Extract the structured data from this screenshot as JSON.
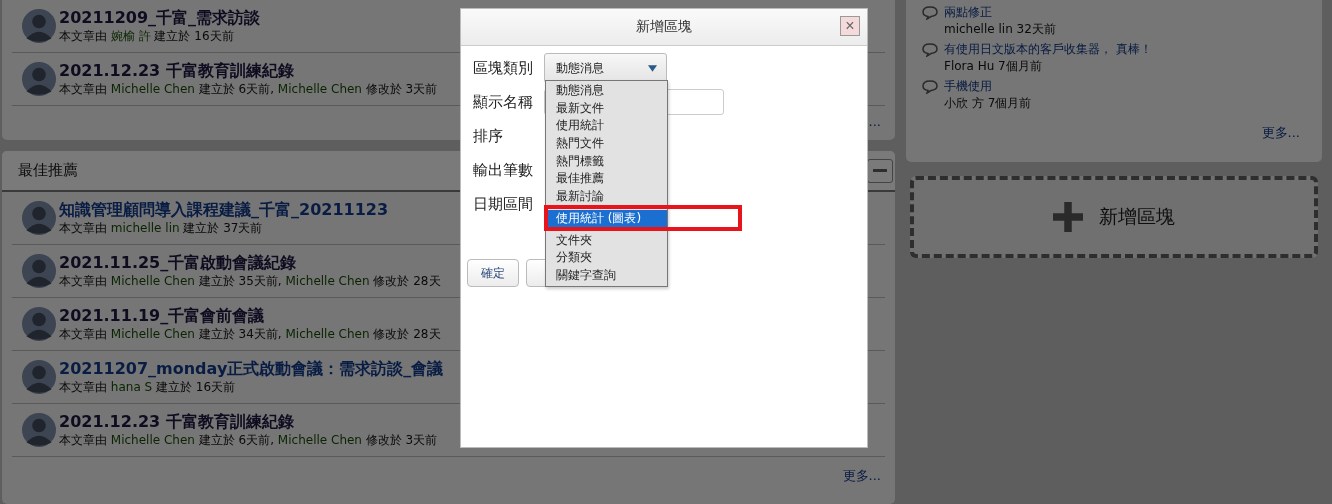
{
  "articles_panel": {
    "rows": [
      {
        "title": "20211209_千富_需求訪談",
        "visited": true,
        "meta": [
          {
            "kind": "text",
            "text": "本文章由 "
          },
          {
            "kind": "name",
            "text": "婉榆 許"
          },
          {
            "kind": "text",
            "text": " 建立於 16天前"
          }
        ]
      },
      {
        "title": "2021.12.23 千富教育訓練紀錄",
        "visited": true,
        "meta": [
          {
            "kind": "text",
            "text": "本文章由 "
          },
          {
            "kind": "name",
            "text": "Michelle Chen"
          },
          {
            "kind": "text",
            "text": " 建立於 6天前, "
          },
          {
            "kind": "name",
            "text": "Michelle Chen"
          },
          {
            "kind": "text",
            "text": " 修改於 3天前"
          }
        ]
      }
    ],
    "more": "..."
  },
  "recommended_panel": {
    "title": "最佳推薦",
    "rows": [
      {
        "title": "知識管理顧問導入課程建議_千富_20211123",
        "visited": false,
        "meta": [
          {
            "kind": "text",
            "text": "本文章由 "
          },
          {
            "kind": "name",
            "text": "michelle lin"
          },
          {
            "kind": "text",
            "text": " 建立於 37天前"
          }
        ]
      },
      {
        "title": "2021.11.25_千富啟動會議紀錄",
        "visited": true,
        "meta": [
          {
            "kind": "text",
            "text": "本文章由 "
          },
          {
            "kind": "name",
            "text": "Michelle Chen"
          },
          {
            "kind": "text",
            "text": " 建立於 35天前, "
          },
          {
            "kind": "name",
            "text": "Michelle Chen"
          },
          {
            "kind": "text",
            "text": " 修改於 28天"
          }
        ]
      },
      {
        "title": "2021.11.19_千富會前會議",
        "visited": true,
        "meta": [
          {
            "kind": "text",
            "text": "本文章由 "
          },
          {
            "kind": "name",
            "text": "Michelle Chen"
          },
          {
            "kind": "text",
            "text": " 建立於 34天前, "
          },
          {
            "kind": "name",
            "text": "Michelle Chen"
          },
          {
            "kind": "text",
            "text": " 修改於 28天"
          }
        ]
      },
      {
        "title": "20211207_monday正式啟動會議：需求訪談_會議",
        "visited": false,
        "meta": [
          {
            "kind": "text",
            "text": "本文章由 "
          },
          {
            "kind": "name",
            "text": "hana S"
          },
          {
            "kind": "text",
            "text": " 建立於 16天前"
          }
        ]
      },
      {
        "title": "2021.12.23 千富教育訓練紀錄",
        "visited": true,
        "meta": [
          {
            "kind": "text",
            "text": "本文章由 "
          },
          {
            "kind": "name",
            "text": "Michelle Chen"
          },
          {
            "kind": "text",
            "text": " 建立於 6天前, "
          },
          {
            "kind": "name",
            "text": "Michelle Chen"
          },
          {
            "kind": "text",
            "text": " 修改於 3天前"
          }
        ]
      }
    ],
    "more": "更多..."
  },
  "comments_panel": {
    "comments": [
      {
        "title": "兩點修正",
        "meta": "michelle lin 32天前"
      },
      {
        "title": "有使用日文版本的客戶收集器， 真棒！",
        "meta": "Flora Hu 7個月前"
      },
      {
        "title": "手機使用",
        "meta": "小欣 方 7個月前"
      }
    ],
    "more": "更多..."
  },
  "add_block": {
    "label": "新增區塊"
  },
  "dialog": {
    "title": "新增區塊",
    "close": "×",
    "fields": [
      {
        "label": "區塊類別",
        "kind": "select",
        "value": "動態消息",
        "expanded": true
      },
      {
        "label": "顯示名稱",
        "kind": "text"
      },
      {
        "label": "排序",
        "kind": "label"
      },
      {
        "label": "輸出筆數",
        "kind": "label"
      },
      {
        "label": "日期區間",
        "kind": "label"
      }
    ],
    "options": [
      {
        "label": "動態消息",
        "selected": false
      },
      {
        "label": "最新文件",
        "selected": false
      },
      {
        "label": "使用統計",
        "selected": false
      },
      {
        "label": "熱門文件",
        "selected": false
      },
      {
        "label": "熱門標籤",
        "selected": false
      },
      {
        "label": "最佳推薦",
        "selected": false
      },
      {
        "label": "最新討論",
        "selected": false
      },
      {
        "label": "使用統計 (圖表)",
        "selected": true
      },
      {
        "label": "文件夾",
        "selected": false
      },
      {
        "label": "分類夾",
        "selected": false
      },
      {
        "label": "關鍵字查詢",
        "selected": false
      }
    ],
    "confirm": "確定"
  }
}
